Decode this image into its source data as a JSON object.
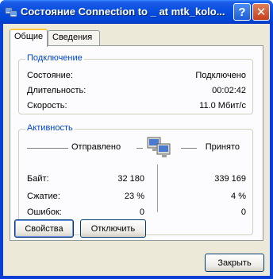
{
  "window": {
    "title": "Состояние Connection to _ at mtk_kolo...",
    "help_label": "?",
    "close_label": "✕"
  },
  "tabs": [
    {
      "label": "Общие",
      "active": true
    },
    {
      "label": "Сведения",
      "active": false
    }
  ],
  "connection": {
    "legend": "Подключение",
    "rows": [
      {
        "label": "Состояние:",
        "value": "Подключено"
      },
      {
        "label": "Длительность:",
        "value": "00:02:42"
      },
      {
        "label": "Скорость:",
        "value": "11.0 Мбит/с"
      }
    ]
  },
  "activity": {
    "legend": "Активность",
    "sent_label": "Отправлено",
    "received_label": "Принято",
    "rows": [
      {
        "label": "Байт:",
        "sent": "32 180",
        "received": "339 169"
      },
      {
        "label": "Сжатие:",
        "sent": "23 %",
        "received": "4 %"
      },
      {
        "label": "Ошибок:",
        "sent": "0",
        "received": "0"
      }
    ]
  },
  "buttons": {
    "properties": "Свойства",
    "disconnect": "Отключить",
    "close": "Закрыть"
  },
  "colors": {
    "titlebar": "#0a4fe0",
    "dialog_bg": "#ece9d8",
    "group_legend": "#0046d5"
  }
}
